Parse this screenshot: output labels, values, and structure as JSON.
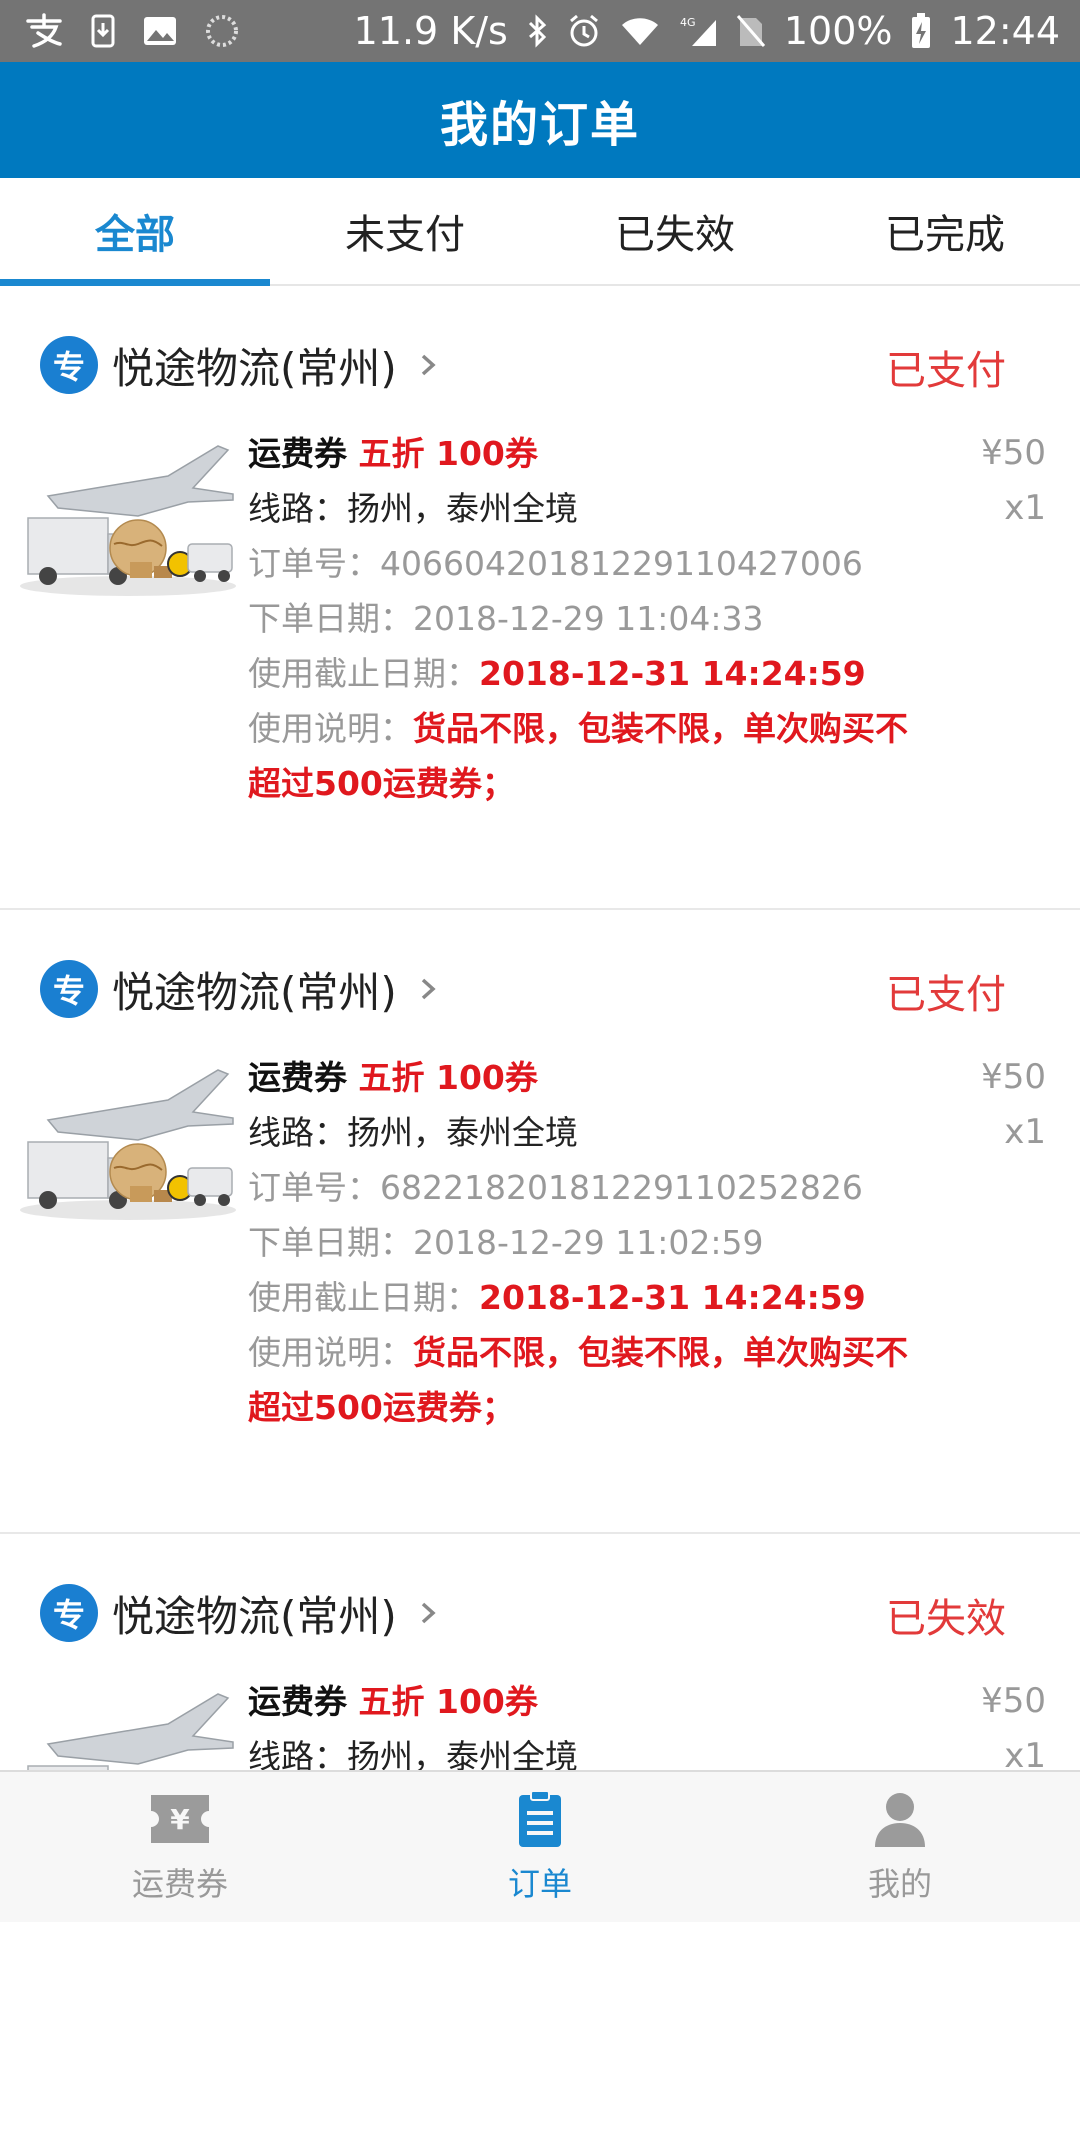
{
  "status_bar": {
    "net_speed": "11.9 K/s",
    "battery": "100%",
    "time": "12:44",
    "signal_label": "4G"
  },
  "header": {
    "title": "我的订单"
  },
  "tabs": [
    {
      "label": "全部",
      "active": true
    },
    {
      "label": "未支付",
      "active": false
    },
    {
      "label": "已失效",
      "active": false
    },
    {
      "label": "已完成",
      "active": false
    }
  ],
  "orders": [
    {
      "shop_badge": "专",
      "shop_name": "悦途物流(常州)",
      "status": "已支付",
      "title_prefix": "运费券",
      "title_highlight": "五折 100券",
      "route_label": "线路：",
      "route_value": "扬州，泰州全境",
      "order_no_label": "订单号：",
      "order_no": "40660420181229110427006",
      "order_date_label": "下单日期：",
      "order_date": "2018-12-29 11:04:33",
      "deadline_label": "使用截止日期：",
      "deadline": "2018-12-31 14:24:59",
      "desc_label": "使用说明：",
      "desc_value": "货品不限，包装不限，单次购买不超过500运费券；",
      "price": "¥50",
      "qty": "x1"
    },
    {
      "shop_badge": "专",
      "shop_name": "悦途物流(常州)",
      "status": "已支付",
      "title_prefix": "运费券",
      "title_highlight": "五折 100券",
      "route_label": "线路：",
      "route_value": "扬州，泰州全境",
      "order_no_label": "订单号：",
      "order_no": "68221820181229110252826",
      "order_date_label": "下单日期：",
      "order_date": "2018-12-29 11:02:59",
      "deadline_label": "使用截止日期：",
      "deadline": "2018-12-31 14:24:59",
      "desc_label": "使用说明：",
      "desc_value": "货品不限，包装不限，单次购买不超过500运费券；",
      "price": "¥50",
      "qty": "x1"
    },
    {
      "shop_badge": "专",
      "shop_name": "悦途物流(常州)",
      "status": "已失效",
      "title_prefix": "运费券",
      "title_highlight": "五折 100券",
      "route_label": "线路：",
      "route_value": "扬州，泰州全境",
      "price": "¥50",
      "qty": "x1"
    }
  ],
  "bottom_nav": [
    {
      "label": "运费券",
      "icon": "coupon-icon",
      "active": false
    },
    {
      "label": "订单",
      "icon": "clipboard-icon",
      "active": true
    },
    {
      "label": "我的",
      "icon": "user-icon",
      "active": false
    }
  ],
  "colors": {
    "brand_blue": "#0079bf",
    "tab_active": "#1a88d0",
    "status_red": "#e23a3a",
    "highlight_red": "#e0181e"
  }
}
